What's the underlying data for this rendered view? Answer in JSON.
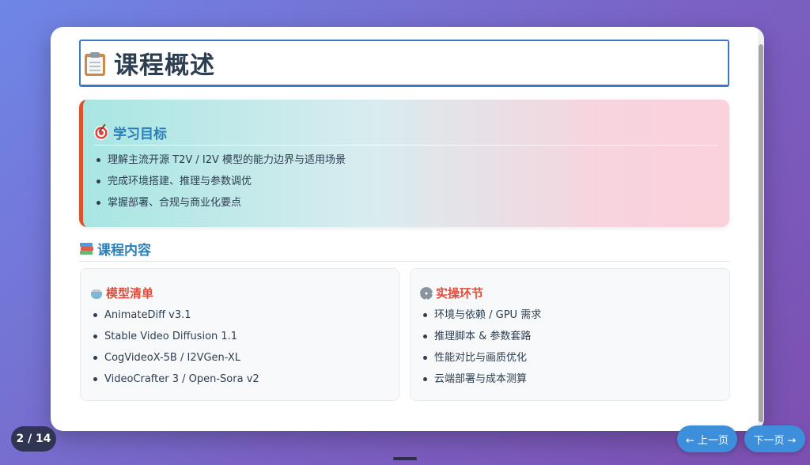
{
  "slide": {
    "title": "课程概述",
    "goals": {
      "heading": "学习目标",
      "items": [
        "理解主流开源 T2V / I2V 模型的能力边界与适用场景",
        "完成环境搭建、推理与参数调优",
        "掌握部署、合规与商业化要点"
      ]
    },
    "content": {
      "heading": "课程内容",
      "models": {
        "heading": "模型清单",
        "items": [
          "AnimateDiff v3.1",
          "Stable Video Diffusion 1.1",
          "CogVideoX-5B / I2VGen-XL",
          "VideoCrafter 3 / Open-Sora v2"
        ]
      },
      "practice": {
        "heading": "实操环节",
        "items": [
          "环境与依赖 / GPU 需求",
          "推理脚本 & 参数套路",
          "性能对比与画质优化",
          "云端部署与成本测算"
        ]
      }
    }
  },
  "navigation": {
    "page_indicator": "2 / 14",
    "prev_label": "← 上一页",
    "next_label": "下一页 →"
  },
  "icons": {
    "title": "clipboard-icon",
    "goals": "target-icon",
    "content": "books-icon",
    "models": "pot-icon",
    "practice": "gear-icon"
  },
  "colors": {
    "accent_blue": "#2a7fb8",
    "accent_red": "#e24d3b",
    "nav_button": "#3d8fdb",
    "indicator_bg": "#2f3553"
  }
}
